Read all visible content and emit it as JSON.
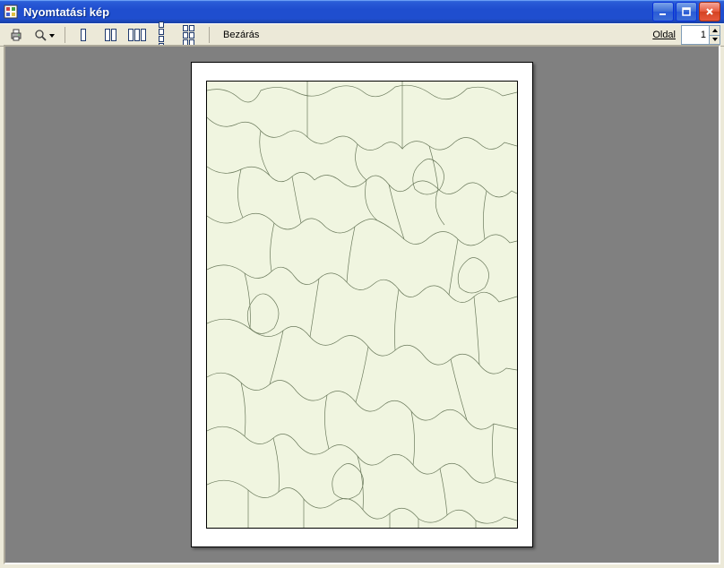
{
  "window": {
    "title": "Nyomtatási kép"
  },
  "toolbar": {
    "close_label": "Bezárás",
    "page_label": "Oldal",
    "page_value": "1"
  }
}
